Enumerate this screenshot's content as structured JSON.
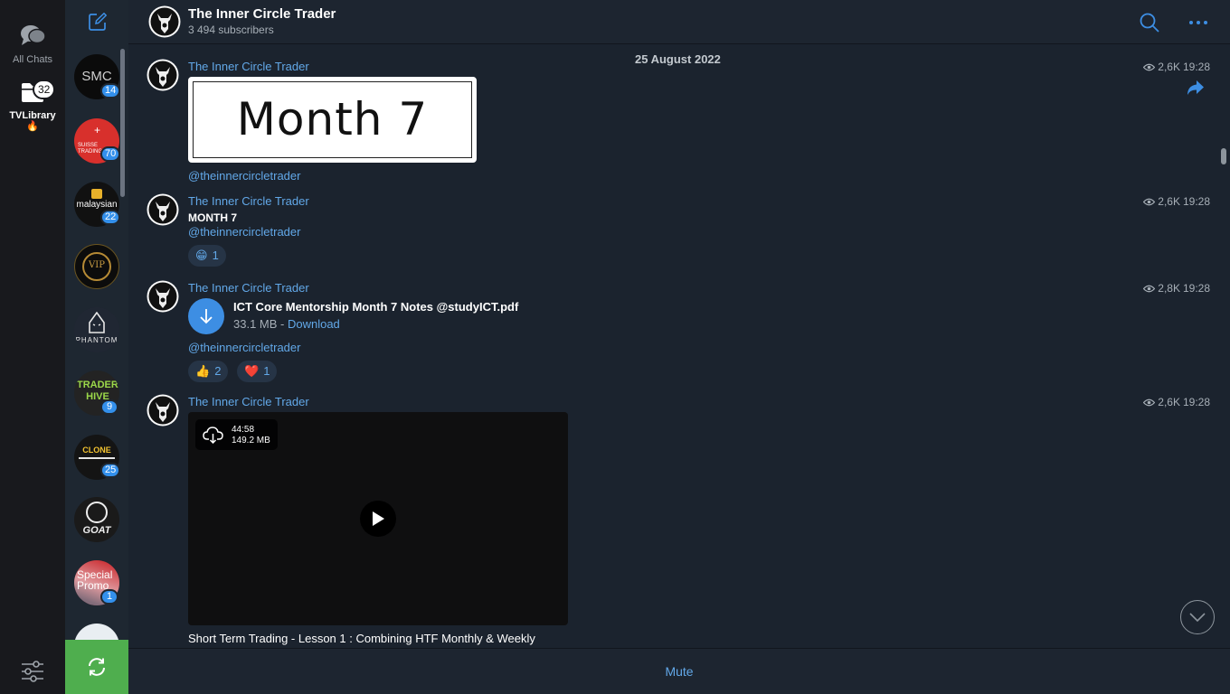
{
  "folders": [
    {
      "label": "All Chats",
      "badge": ""
    },
    {
      "label": "TVLibrary",
      "badge": "32",
      "emoji": "🔥"
    }
  ],
  "chats": [
    {
      "name": "SMC",
      "badge": "14",
      "color": "#0b0b0b"
    },
    {
      "name": "SUISSE TRADING",
      "badge": "70",
      "color": "#d8302c"
    },
    {
      "name": "malaysian",
      "badge": "22",
      "color": "#111111"
    },
    {
      "name": "VIP",
      "badge": "",
      "color": "#0c0c0c"
    },
    {
      "name": "PHANTOM",
      "badge": "",
      "color": "#202733"
    },
    {
      "name": "TRADERS HIVE",
      "badge": "9",
      "color": "#232323"
    },
    {
      "name": "CLONE",
      "badge": "25",
      "color": "#141414"
    },
    {
      "name": "GOAT",
      "badge": "",
      "color": "#1a1a1a"
    },
    {
      "name": "Special Promo",
      "badge": "1",
      "color": "#b8202a"
    },
    {
      "name": "",
      "badge": "",
      "color": "#e9eef2"
    }
  ],
  "header": {
    "title": "The Inner Circle Trader",
    "subscribers": "3 494 subscribers"
  },
  "date_separator": "25 August 2022",
  "messages": [
    {
      "author": "The Inner Circle Trader",
      "views": "2,6K",
      "time": "19:28",
      "image_text": "Month 7",
      "link": "@theinnercircletrader"
    },
    {
      "author": "The Inner Circle Trader",
      "views": "2,6K",
      "time": "19:28",
      "bold": "MONTH 7",
      "link": "@theinnercircletrader",
      "reactions": [
        {
          "emoji": "😁",
          "count": "1"
        }
      ]
    },
    {
      "author": "The Inner Circle Trader",
      "views": "2,8K",
      "time": "19:28",
      "file_name": "ICT Core Mentorship Month 7 Notes @studyICT.pdf",
      "file_size": "33.1 MB - ",
      "file_action": "Download",
      "link": "@theinnercircletrader",
      "reactions": [
        {
          "emoji": "👍",
          "count": "2"
        },
        {
          "emoji": "❤️",
          "count": "1"
        }
      ]
    },
    {
      "author": "The Inner Circle Trader",
      "views": "2,6K",
      "time": "19:28",
      "video_duration": "44:58",
      "video_size": "149.2 MB",
      "caption": "Short Term Trading - Lesson 1 : Combining HTF Monthly & Weekly"
    }
  ],
  "bottom": {
    "mute_label": "Mute"
  },
  "colors": {
    "accent": "#3390ec",
    "link": "#62a8e8",
    "update_button": "#4fae4e"
  }
}
